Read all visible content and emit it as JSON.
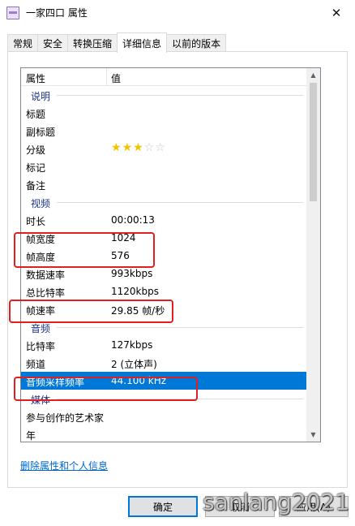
{
  "window": {
    "title": "一家四口 属性",
    "close_glyph": "✕"
  },
  "tabs": [
    "常规",
    "安全",
    "转换压缩",
    "详细信息",
    "以前的版本"
  ],
  "list": {
    "header": {
      "property": "属性",
      "value": "值"
    },
    "groups": {
      "description": "说明",
      "video": "视频",
      "audio": "音频",
      "media": "媒体"
    },
    "rows": {
      "title": {
        "k": "标题",
        "v": ""
      },
      "subtitle": {
        "k": "副标题",
        "v": ""
      },
      "rating": {
        "k": "分级",
        "stars_filled": 3,
        "stars_total": 5
      },
      "tags": {
        "k": "标记",
        "v": ""
      },
      "comments": {
        "k": "备注",
        "v": ""
      },
      "duration": {
        "k": "时长",
        "v": "00:00:13"
      },
      "frame_width": {
        "k": "帧宽度",
        "v": "1024"
      },
      "frame_height": {
        "k": "帧高度",
        "v": "576"
      },
      "data_rate": {
        "k": "数据速率",
        "v": "993kbps"
      },
      "total_bitrate": {
        "k": "总比特率",
        "v": "1120kbps"
      },
      "frame_rate": {
        "k": "帧速率",
        "v": "29.85 帧/秒"
      },
      "bit_rate": {
        "k": "比特率",
        "v": "127kbps"
      },
      "channels": {
        "k": "频道",
        "v": "2 (立体声)"
      },
      "sample_rate": {
        "k": "音频采样频率",
        "v": "44.100 kHz"
      },
      "contributing_artists": {
        "k": "参与创作的艺术家",
        "v": ""
      },
      "year": {
        "k": "年",
        "v": ""
      }
    }
  },
  "link": "删除属性和个人信息",
  "buttons": {
    "ok": "确定",
    "cancel": "取消",
    "apply": "应用(A)"
  },
  "watermark": "sanlang2021",
  "colors": {
    "selection": "#0078d7",
    "highlight_box": "#e02020",
    "link": "#0066cc"
  }
}
